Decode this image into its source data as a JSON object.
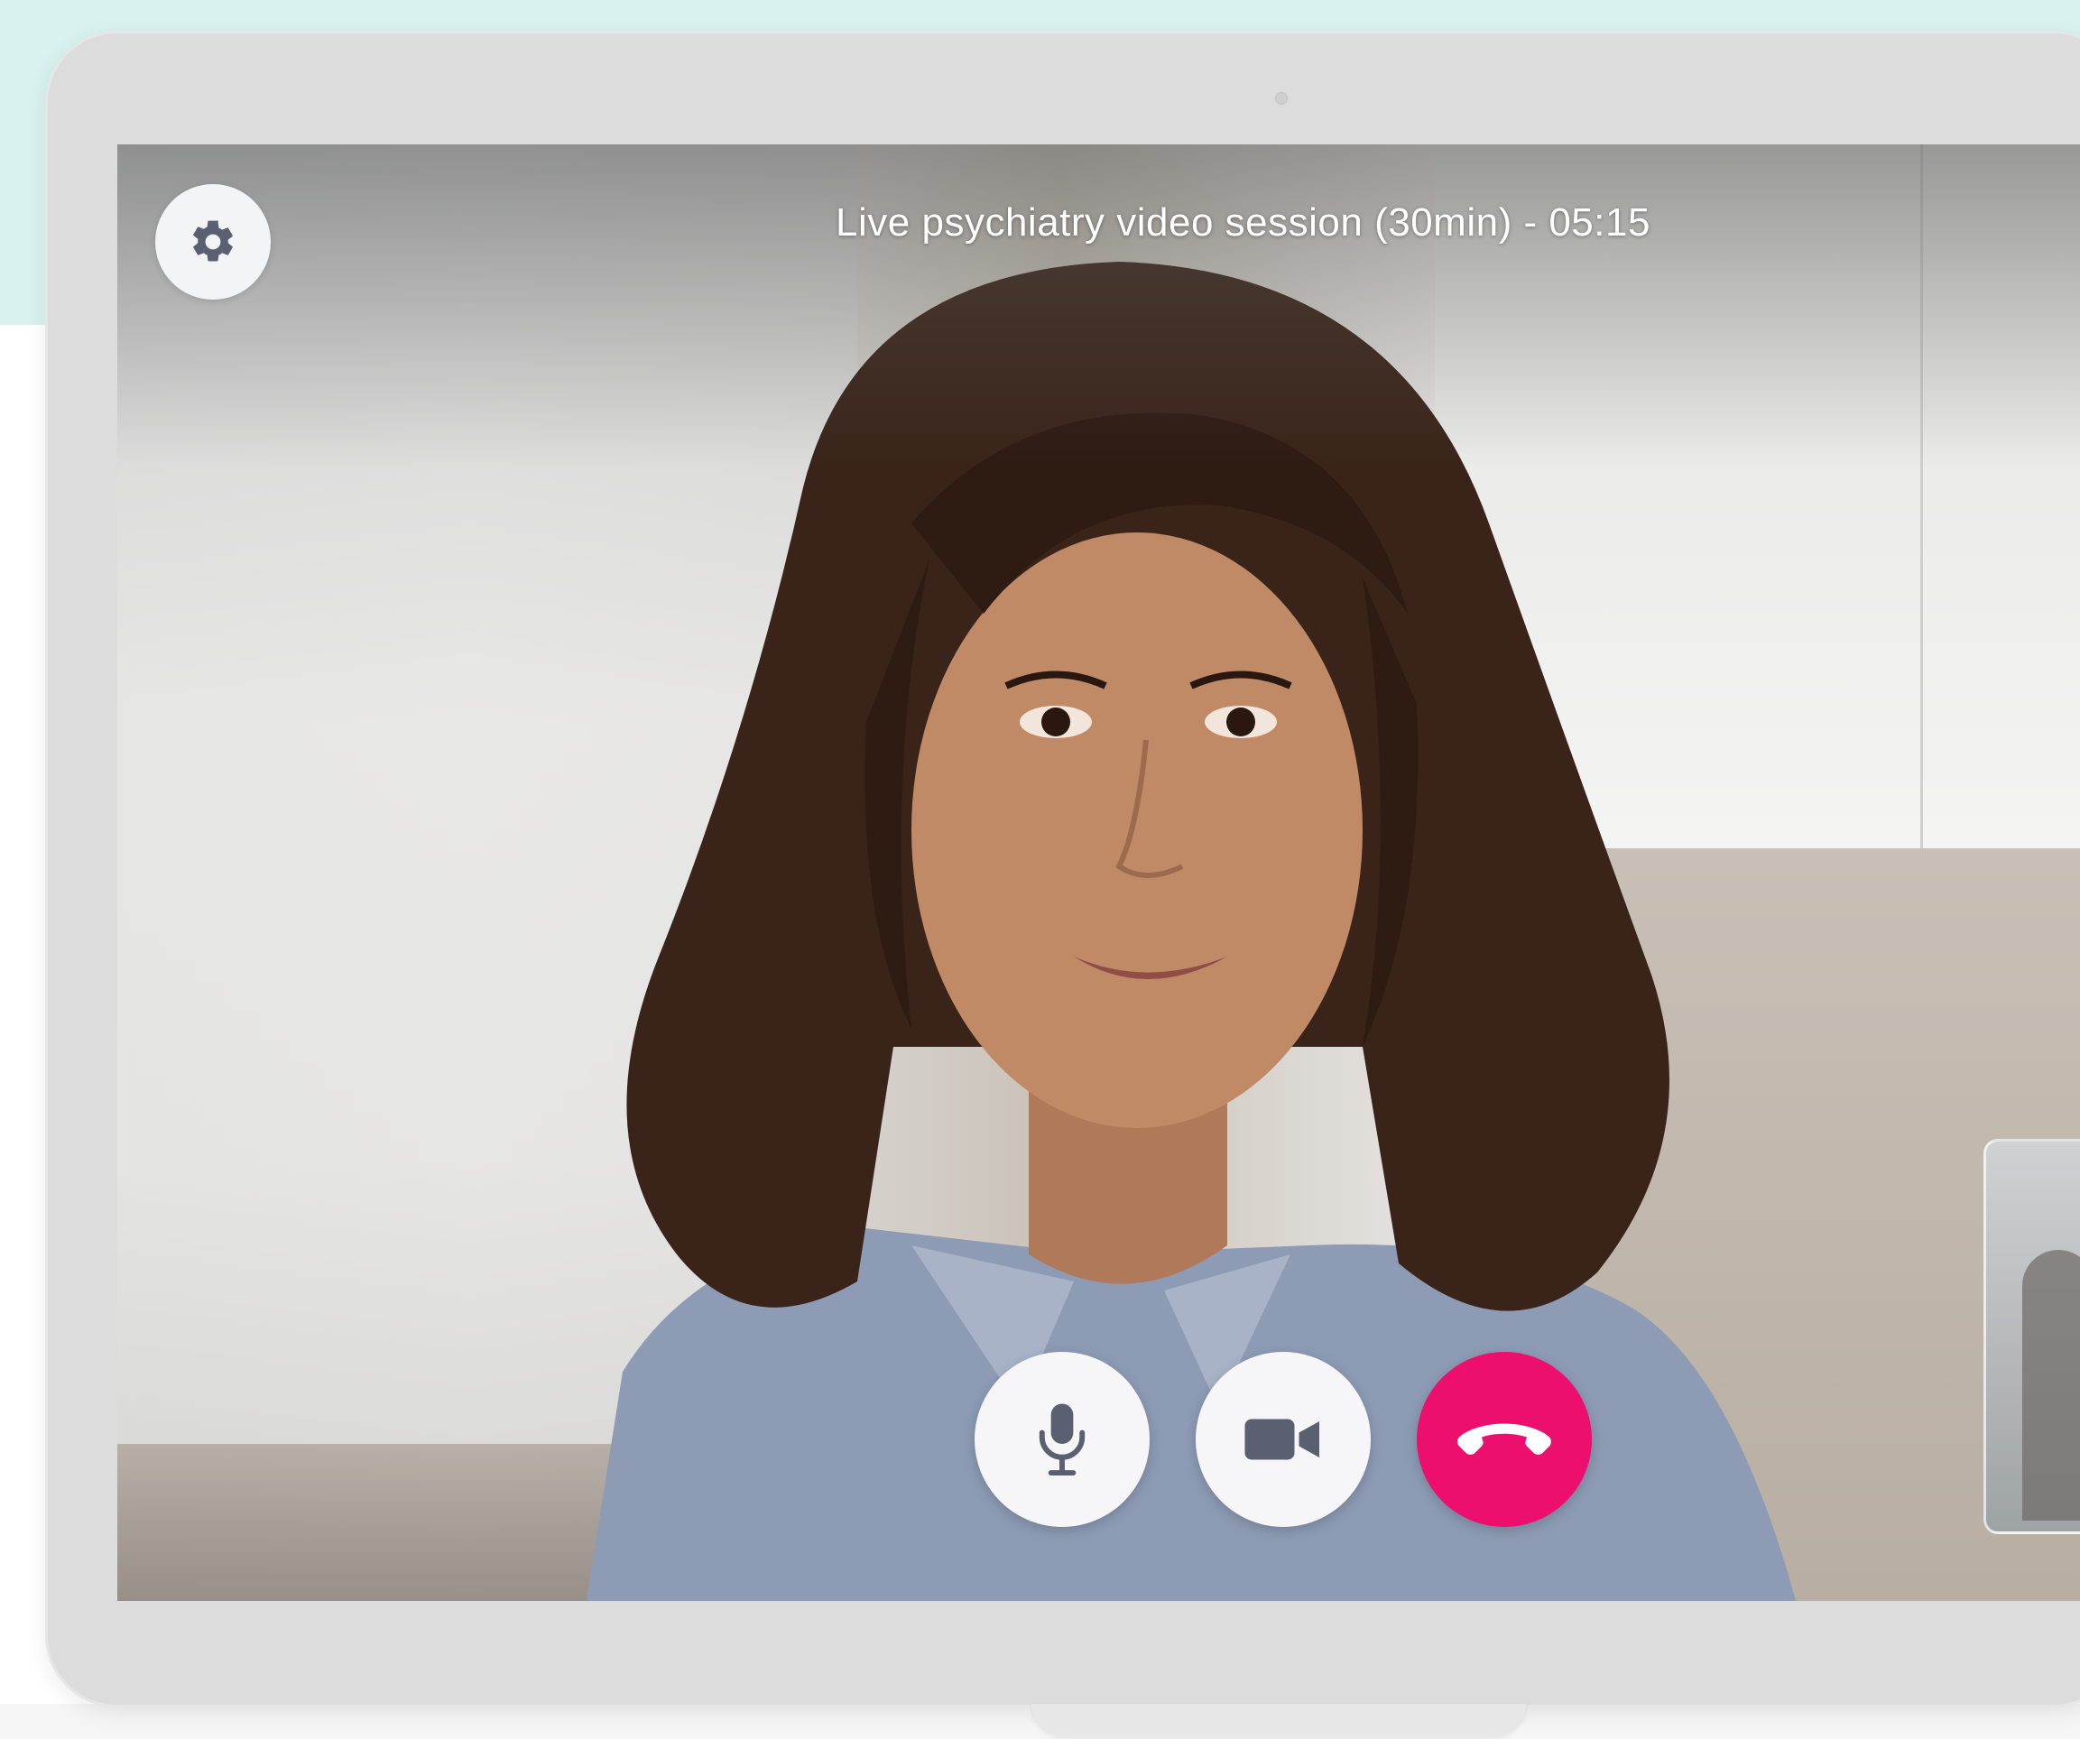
{
  "session": {
    "title": "Live psychiatry video session (30min) - 05:15"
  },
  "controls": {
    "settings_icon": "gear-icon",
    "mic_icon": "microphone-icon",
    "camera_icon": "video-camera-icon",
    "end_call_icon": "hang-up-phone-icon"
  },
  "colors": {
    "end_call": "#ec0f6e",
    "button_bg": "#f6f6f8",
    "icon": "#5b6070",
    "accent_bg": "#d8f3ef"
  }
}
